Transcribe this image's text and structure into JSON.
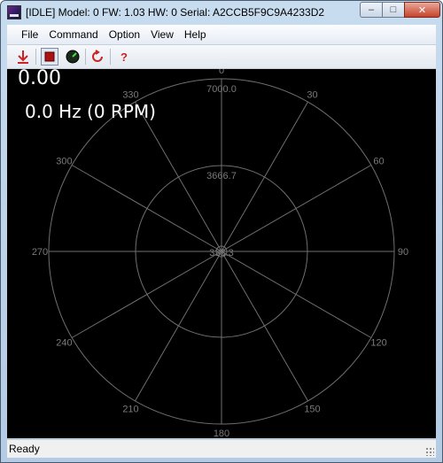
{
  "window": {
    "title": "[IDLE] Model: 0 FW: 1.03 HW: 0 Serial: A2CCB5F9C9A4233D2",
    "min_glyph": "–",
    "max_glyph": "□",
    "close_glyph": "✕"
  },
  "menu": {
    "items": [
      {
        "label": "File"
      },
      {
        "label": "Command"
      },
      {
        "label": "Option"
      },
      {
        "label": "View"
      },
      {
        "label": "Help"
      }
    ]
  },
  "toolbar": {
    "tools": [
      {
        "icon": "download-arrow-icon",
        "glyph": "⤓",
        "color": "#cc2222"
      },
      {
        "icon": "stop-icon",
        "glyph": "■",
        "color": "#aa1111"
      },
      {
        "icon": "gauge-icon",
        "glyph": "●",
        "color": "#1a3a1a"
      },
      {
        "icon": "refresh-icon",
        "glyph": "↻",
        "color": "#cc2222"
      },
      {
        "icon": "help-icon",
        "glyph": "?",
        "color": "#cc2222"
      }
    ]
  },
  "readout": {
    "value": "0.00",
    "frequency": "0.0 Hz (0 RPM)"
  },
  "polar": {
    "angle_labels": [
      "0",
      "30",
      "60",
      "90",
      "120",
      "150",
      "180",
      "210",
      "240",
      "270",
      "300",
      "330"
    ],
    "radial_labels": [
      "7000.0",
      "3666.7",
      "333.3"
    ],
    "grid_color": "#6f6f6f",
    "label_color": "#7a7a7a"
  },
  "status": {
    "text": "Ready"
  }
}
